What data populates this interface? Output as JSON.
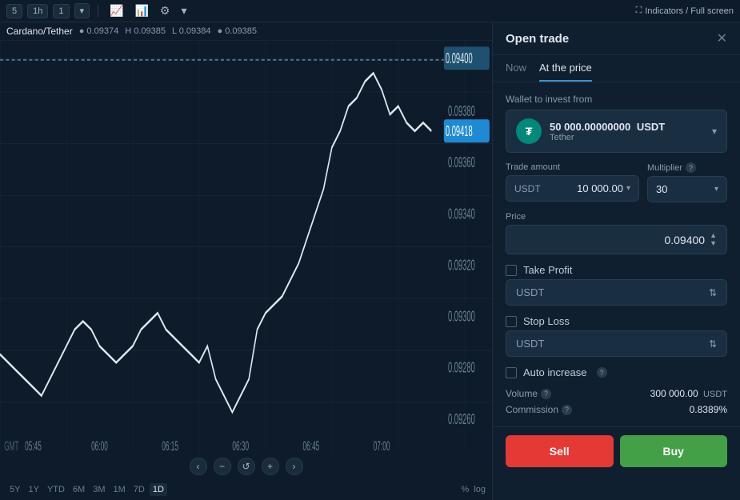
{
  "toolbar": {
    "interval_5": "5",
    "interval_1h": "1h",
    "interval_1": "1",
    "dropdown_arrow": "▾",
    "fullscreen_label": "Indicators / Full screen",
    "icons": [
      "📈",
      "📊",
      "⚙"
    ]
  },
  "chart": {
    "symbol": "Cardano/Tether",
    "prices": {
      "o": "0.09374",
      "h": "0.09385",
      "l": "0.09384",
      "c": "0.09385"
    },
    "current_price": "0.09418",
    "dashed_price": "0.09400",
    "price_levels": [
      "0.09400",
      "0.09380",
      "0.09360",
      "0.09340",
      "0.09320",
      "0.09300",
      "0.09280",
      "0.09260"
    ],
    "time_labels": [
      "05:45",
      "06:00",
      "06:15",
      "06:30",
      "06:45",
      "07:00"
    ],
    "gmt": "GMT",
    "time_scales": [
      "5Y",
      "1Y",
      "YTD",
      "6M",
      "3M",
      "1M",
      "7D",
      "1D"
    ],
    "time_scale_extra": [
      "%",
      "log"
    ]
  },
  "panel": {
    "title": "Open trade",
    "tabs": [
      "Now",
      "At the price"
    ],
    "active_tab": 1,
    "wallet_section_label": "Wallet to invest from",
    "wallet": {
      "icon_text": "₮",
      "amount": "50 000.00000000",
      "currency": "USDT",
      "name": "Tether"
    },
    "trade_amount_label": "Trade amount",
    "multiplier_label": "Multiplier",
    "trade_currency": "USDT",
    "trade_value": "10 000.00",
    "multiplier_value": "30",
    "price_section_label": "Price",
    "price_value": "0.09400",
    "take_profit_label": "Take Profit",
    "take_profit_currency": "USDT",
    "stop_loss_label": "Stop Loss",
    "stop_loss_currency": "USDT",
    "auto_increase_label": "Auto increase",
    "volume_label": "Volume",
    "volume_value": "300 000.00",
    "volume_unit": "USDT",
    "commission_label": "Commission",
    "commission_value": "0.8389%",
    "sell_label": "Sell",
    "buy_label": "Buy"
  }
}
